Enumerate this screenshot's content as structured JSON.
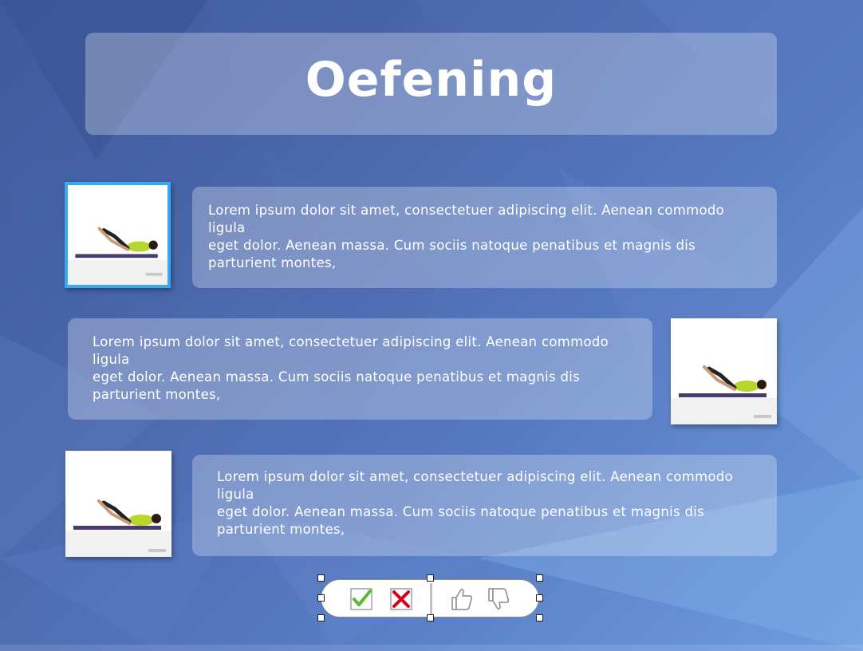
{
  "slide": {
    "title": "Oefening"
  },
  "rows": [
    {
      "text": "Lorem ipsum dolor sit amet, consectetuer adipiscing elit. Aenean commodo ligula\neget dolor. Aenean massa. Cum sociis natoque penatibus et magnis dis parturient montes,",
      "image": "crunch-exercise-photo",
      "selected": true
    },
    {
      "text": "Lorem ipsum dolor sit amet, consectetuer adipiscing elit. Aenean commodo ligula\neget dolor. Aenean massa. Cum sociis natoque penatibus et magnis dis parturient montes,",
      "image": "crunch-exercise-photo",
      "selected": false
    },
    {
      "text": "Lorem ipsum dolor sit amet, consectetuer adipiscing elit. Aenean commodo ligula\neget dolor. Aenean massa. Cum sociis natoque penatibus et magnis dis parturient montes,",
      "image": "crunch-exercise-photo",
      "selected": false
    }
  ],
  "toolbar": {
    "icons": [
      "check-icon",
      "cross-icon",
      "thumbs-up-icon",
      "thumbs-down-icon"
    ],
    "colors": {
      "check": "#5cb82e",
      "cross": "#d0021b",
      "thumbs": "#8a8a8a"
    }
  },
  "colors": {
    "background": "#4a66ab",
    "selection_border": "#3aa8ee",
    "panel": "rgba(255,255,255,0.28)"
  }
}
